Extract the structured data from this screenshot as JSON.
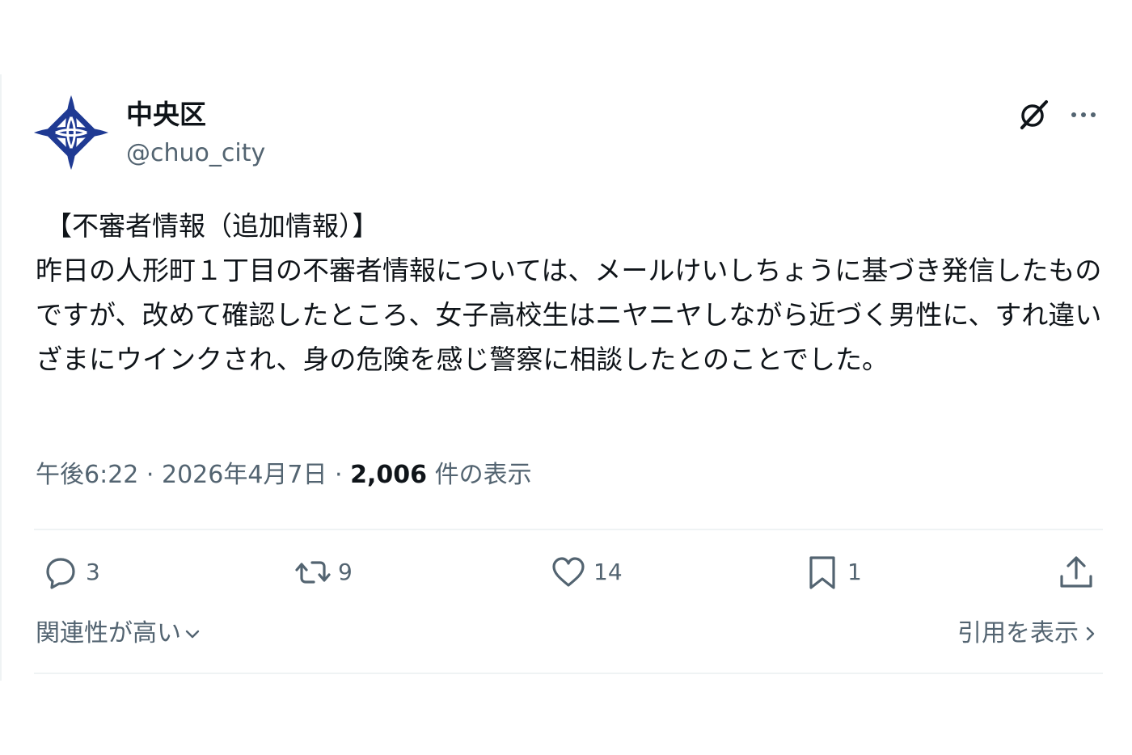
{
  "author": {
    "display_name": "中央区",
    "handle": "@chuo_city"
  },
  "post": {
    "heading": "【不審者情報（追加情報）】",
    "text": "昨日の人形町１丁目の不審者情報については、メールけいしちょうに基づき発信したものですが、改めて確認したところ、女子高校生はニヤニヤしながら近づく男性に、すれ違いざまにウインクされ、身の危険を感じ警察に相談したとのことでした。"
  },
  "meta": {
    "time": "午後6:22",
    "separator": " · ",
    "date": "2026年4月7日",
    "views_count": "2,006",
    "views_label": " 件の表示"
  },
  "actions": {
    "reply_count": "3",
    "repost_count": "9",
    "like_count": "14",
    "bookmark_count": "1"
  },
  "footer": {
    "sort_label": "関連性が高い",
    "quotes_label": "引用を表示"
  },
  "icons": {
    "avatar": "chuo-city-emblem",
    "grok": "grok-icon",
    "more": "more-dots-icon",
    "reply": "reply-icon",
    "repost": "repost-icon",
    "like": "heart-icon",
    "bookmark": "bookmark-icon",
    "share": "share-icon"
  },
  "colors": {
    "emblem": "#1f3a93",
    "text_primary": "#0f1419",
    "text_secondary": "#536471",
    "divider": "#eff3f4"
  }
}
